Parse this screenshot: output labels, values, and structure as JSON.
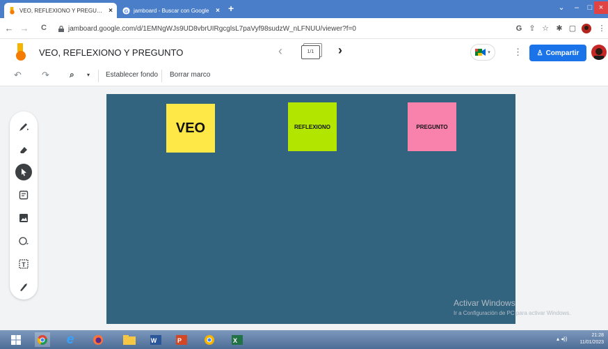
{
  "browser": {
    "tabs": [
      {
        "title": "VEO, REFLEXIONO Y PREGUNTO",
        "close": "×",
        "active": true
      },
      {
        "title": "jamboard - Buscar con Google",
        "close": "×",
        "active": false
      }
    ],
    "new_tab": "+",
    "window_controls": {
      "dropdown": "⌄",
      "minimize": "–",
      "maximize": "□",
      "close": "×"
    },
    "url": "jamboard.google.com/d/1EMNgWJs9UD8vbrUIRgcglsL7paVyf98sudzW_nLFNUU/viewer?f=0",
    "nav": {
      "back": "←",
      "forward": "→",
      "reload": "C"
    },
    "icons": [
      "google-g-icon",
      "share-icon",
      "star-icon",
      "extensions-icon",
      "sidepanel-icon",
      "profile-avatar-icon",
      "menu-icon"
    ]
  },
  "app": {
    "title": "VEO, REFLEXIONO Y PREGUNTO",
    "frame_counter": "1/1",
    "prev_frame": "‹",
    "next_frame": "›",
    "share_label": "Compartir",
    "more_menu": "⋮"
  },
  "toolbar": {
    "undo": "↶",
    "redo": "↷",
    "zoom_caret": "▾",
    "set_background": "Establecer fondo",
    "clear_frame": "Borrar marco"
  },
  "side_tools": [
    "pen-icon",
    "eraser-icon",
    "select-icon",
    "sticky-note-icon",
    "image-icon",
    "shape-icon",
    "text-box-icon",
    "laser-icon"
  ],
  "canvas": {
    "background": "#32637f",
    "notes": [
      {
        "text": "VEO",
        "color": "#fde847"
      },
      {
        "text": "REFLEXIONO",
        "color": "#b2e601"
      },
      {
        "text": "PREGUNTO",
        "color": "#f882ac"
      }
    ]
  },
  "watermark": {
    "title": "Activar Windows",
    "subtitle": "Ir a Configuración de PC para activar Windows."
  },
  "taskbar": {
    "apps": [
      "windows-start-icon",
      "chrome-icon",
      "internet-explorer-icon",
      "firefox-icon",
      "file-explorer-icon",
      "word-icon",
      "powerpoint-icon",
      "chrome-canary-icon",
      "excel-icon"
    ],
    "time": "21:28",
    "date": "11/01/2023"
  }
}
